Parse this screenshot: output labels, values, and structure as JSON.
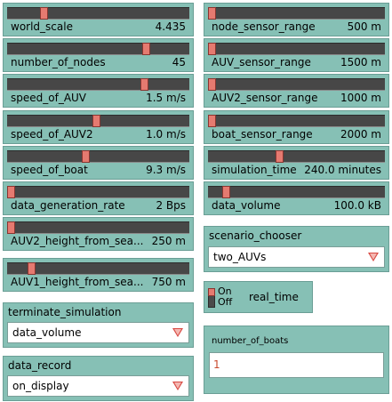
{
  "sliders": [
    {
      "label": "world_scale",
      "value": "4.435",
      "position": 0.2
    },
    {
      "label": "number_of_nodes",
      "value": "45",
      "position": 0.76
    },
    {
      "label": "speed_of_AUV",
      "value": "1.5 m/s",
      "position": 0.75
    },
    {
      "label": "speed_of_AUV2",
      "value": "1.0 m/s",
      "position": 0.49
    },
    {
      "label": "speed_of_boat",
      "value": "9.3 m/s",
      "position": 0.43
    },
    {
      "label": "data_generation_rate",
      "value": "2 Bps",
      "position": 0.02
    },
    {
      "label": "AUV2_height_from_sea...",
      "value": "250 m",
      "position": 0.02
    },
    {
      "label": "AUV1_height_from_sea...",
      "value": "750 m",
      "position": 0.13
    },
    {
      "label": "node_sensor_range",
      "value": "500 m",
      "position": 0.02
    },
    {
      "label": "AUV_sensor_range",
      "value": "1500 m",
      "position": 0.02
    },
    {
      "label": "AUV2_sensor_range",
      "value": "1000 m",
      "position": 0.02
    },
    {
      "label": "boat_sensor_range",
      "value": "2000 m",
      "position": 0.02
    },
    {
      "label": "simulation_time",
      "value": "240.0 minutes",
      "position": 0.4
    },
    {
      "label": "data_volume",
      "value": "100.0 kB",
      "position": 0.1
    }
  ],
  "choosers": {
    "scenario": {
      "title": "scenario_chooser",
      "value": "two_AUVs"
    },
    "terminate": {
      "title": "terminate_simulation",
      "value": "data_volume"
    },
    "record": {
      "title": "data_record",
      "value": "on_display"
    }
  },
  "switch": {
    "on_label": "On",
    "off_label": "Off",
    "label": "real_time",
    "state": "off"
  },
  "monitor": {
    "title": "number_of_boats",
    "value": "1"
  },
  "colors": {
    "widget_bg": "#86c0b5",
    "thumb": "#e57a70",
    "track": "#474747",
    "arrow": "#d84a43"
  }
}
